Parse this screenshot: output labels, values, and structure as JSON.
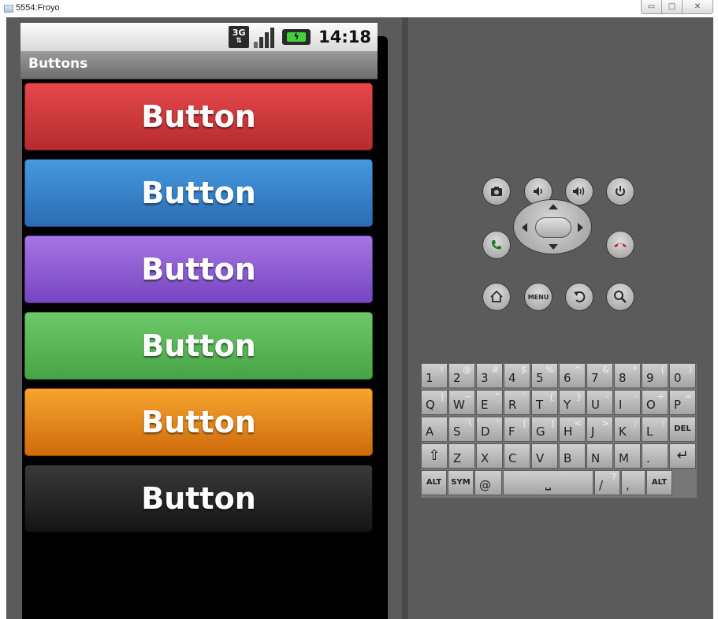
{
  "window": {
    "title": "5554:Froyo",
    "controls": [
      "▭",
      "□",
      "✕"
    ]
  },
  "status_bar": {
    "network": "3G",
    "time": "14:18"
  },
  "app": {
    "title": "Buttons",
    "buttons": [
      {
        "label": "Button",
        "color": "#d63b3e"
      },
      {
        "label": "Button",
        "color": "#3a85cc"
      },
      {
        "label": "Button",
        "color": "#8e5ad3"
      },
      {
        "label": "Button",
        "color": "#5cb85a"
      },
      {
        "label": "Button",
        "color": "#e88a1d"
      },
      {
        "label": "Button",
        "color": "#222222"
      }
    ]
  },
  "hardware_controls": {
    "menu_label": "MENU",
    "icons": [
      "camera-icon",
      "volume-down-icon",
      "volume-up-icon",
      "power-icon",
      "call-icon",
      "dpad",
      "end-call-icon",
      "home-icon",
      "menu-icon",
      "back-icon",
      "search-icon"
    ]
  },
  "keyboard": {
    "rows": [
      [
        {
          "main": "1",
          "alt": "!"
        },
        {
          "main": "2",
          "alt": "@"
        },
        {
          "main": "3",
          "alt": "#"
        },
        {
          "main": "4",
          "alt": "$"
        },
        {
          "main": "5",
          "alt": "%"
        },
        {
          "main": "6",
          "alt": "^"
        },
        {
          "main": "7",
          "alt": "&"
        },
        {
          "main": "8",
          "alt": "*"
        },
        {
          "main": "9",
          "alt": "("
        },
        {
          "main": "0",
          "alt": ")"
        }
      ],
      [
        {
          "main": "Q",
          "alt": "|"
        },
        {
          "main": "W",
          "alt": "~"
        },
        {
          "main": "E",
          "alt": "\""
        },
        {
          "main": "R",
          "alt": "`"
        },
        {
          "main": "T",
          "alt": "{"
        },
        {
          "main": "Y",
          "alt": "}"
        },
        {
          "main": "U",
          "alt": "-"
        },
        {
          "main": "I",
          "alt": "-"
        },
        {
          "main": "O",
          "alt": "+"
        },
        {
          "main": "P",
          "alt": "="
        }
      ],
      [
        {
          "main": "A",
          "alt": ""
        },
        {
          "main": "S",
          "alt": "\\"
        },
        {
          "main": "D",
          "alt": "'"
        },
        {
          "main": "F",
          "alt": "["
        },
        {
          "main": "G",
          "alt": "]"
        },
        {
          "main": "H",
          "alt": "<"
        },
        {
          "main": "J",
          "alt": ">"
        },
        {
          "main": "K",
          "alt": ";"
        },
        {
          "main": "L",
          "alt": ":"
        },
        {
          "label": "DEL"
        }
      ],
      [
        {
          "symbol": "⇧"
        },
        {
          "main": "Z",
          "alt": ""
        },
        {
          "main": "X",
          "alt": ""
        },
        {
          "main": "C",
          "alt": ""
        },
        {
          "main": "V",
          "alt": ""
        },
        {
          "main": "B",
          "alt": ""
        },
        {
          "main": "N",
          "alt": ""
        },
        {
          "main": "M",
          "alt": ""
        },
        {
          "main": ".",
          "alt": ""
        },
        {
          "symbol": "↵"
        }
      ],
      [
        {
          "label": "ALT"
        },
        {
          "label": "SYM"
        },
        {
          "main": "@",
          "alt": ""
        },
        {
          "symbol": "⎵"
        },
        {
          "main": "/",
          "alt": "?"
        },
        {
          "main": ",",
          "alt": ""
        },
        {
          "label": "ALT"
        }
      ]
    ]
  }
}
